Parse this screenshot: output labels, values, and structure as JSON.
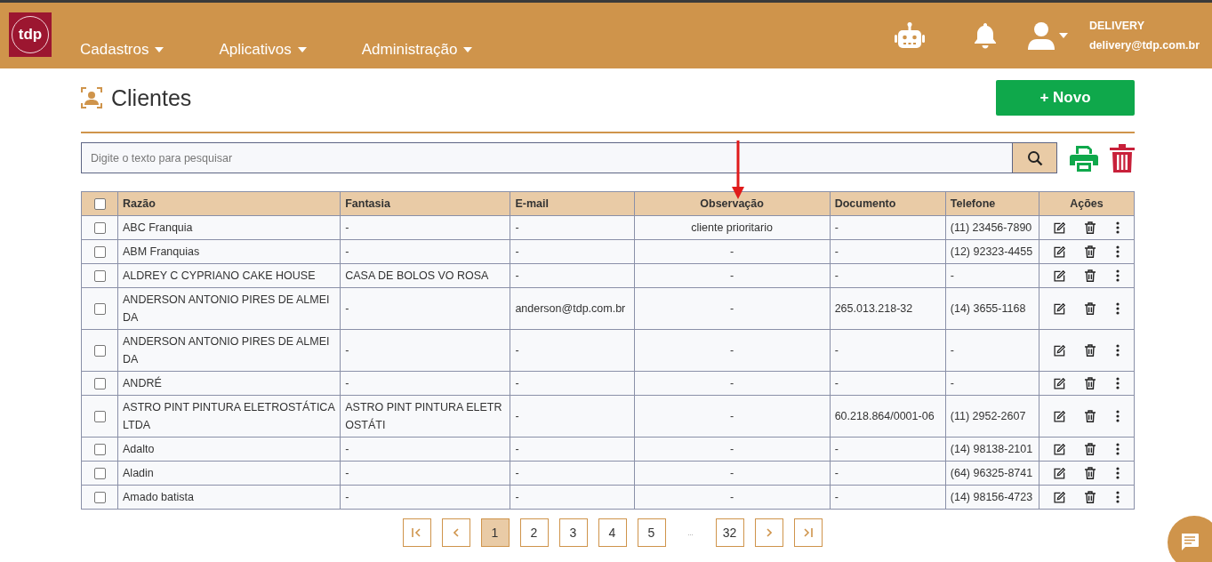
{
  "navbar": {
    "logo": "tdp",
    "menus": [
      {
        "label": "Cadastros"
      },
      {
        "label": "Aplicativos"
      },
      {
        "label": "Administração"
      }
    ],
    "user": {
      "name": "DELIVERY",
      "email": "delivery@tdp.com.br"
    }
  },
  "page": {
    "title": "Clientes",
    "new_button": "+ Novo"
  },
  "search": {
    "placeholder": "Digite o texto para pesquisar"
  },
  "table": {
    "select_all": {
      "checked": false
    },
    "columns": [
      "Razão",
      "Fantasia",
      "E-mail",
      "Observação",
      "Documento",
      "Telefone",
      "Ações"
    ],
    "rows": [
      {
        "checked": false,
        "cells": [
          "ABC Franquia",
          "-",
          "-",
          "cliente prioritario",
          "-",
          "(11) 23456-7890"
        ]
      },
      {
        "checked": false,
        "cells": [
          "ABM Franquias",
          "-",
          "-",
          "-",
          "-",
          "(12) 92323-4455"
        ]
      },
      {
        "checked": false,
        "cells": [
          "ALDREY C CYPRIANO CAKE HOUSE",
          "CASA DE BOLOS VO ROSA",
          "-",
          "-",
          "-",
          "-"
        ]
      },
      {
        "checked": false,
        "cells": [
          "ANDERSON ANTONIO PIRES DE ALMEIDA",
          "-",
          "anderson@tdp.com.br",
          "-",
          "265.013.218-32",
          "(14) 3655-1168"
        ]
      },
      {
        "checked": false,
        "cells": [
          "ANDERSON ANTONIO PIRES DE ALMEIDA",
          "-",
          "-",
          "-",
          "-",
          "-"
        ]
      },
      {
        "checked": false,
        "cells": [
          "ANDRÉ",
          "-",
          "-",
          "-",
          "-",
          "-"
        ]
      },
      {
        "checked": false,
        "cells": [
          "ASTRO PINT PINTURA ELETROSTÁTICA LTDA",
          "ASTRO PINT PINTURA ELETROSTÁTI",
          "-",
          "-",
          "60.218.864/0001-06",
          "(11) 2952-2607"
        ]
      },
      {
        "checked": false,
        "cells": [
          "Adalto",
          "-",
          "-",
          "-",
          "-",
          "(14) 98138-2101"
        ]
      },
      {
        "checked": false,
        "cells": [
          "Aladin",
          "-",
          "-",
          "-",
          "-",
          "(64) 96325-8741"
        ]
      },
      {
        "checked": false,
        "cells": [
          "Amado batista",
          "-",
          "-",
          "-",
          "-",
          "(14) 98156-4723"
        ]
      }
    ]
  },
  "pagination": [
    {
      "kind": "first",
      "selected": false
    },
    {
      "kind": "prev",
      "selected": false
    },
    {
      "kind": "page",
      "label": "1",
      "selected": true
    },
    {
      "kind": "page",
      "label": "2",
      "selected": false
    },
    {
      "kind": "page",
      "label": "3",
      "selected": false
    },
    {
      "kind": "page",
      "label": "4",
      "selected": false
    },
    {
      "kind": "page",
      "label": "5",
      "selected": false
    },
    {
      "kind": "ellipsis",
      "label": "..."
    },
    {
      "kind": "page",
      "label": "32",
      "selected": false
    },
    {
      "kind": "next",
      "selected": false
    },
    {
      "kind": "last",
      "selected": false
    }
  ]
}
